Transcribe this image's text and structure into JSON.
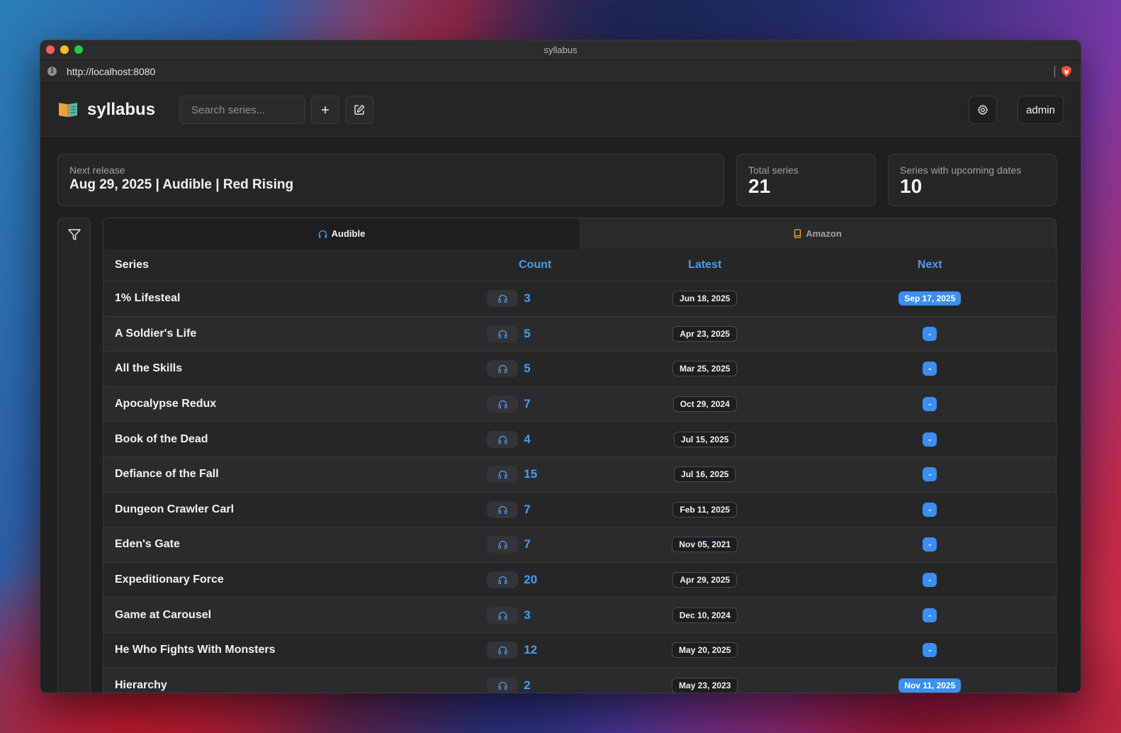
{
  "window": {
    "title": "syllabus",
    "url": "http://localhost:8080"
  },
  "header": {
    "app_name": "syllabus",
    "search_placeholder": "Search series...",
    "user_label": "admin"
  },
  "stats": {
    "next_release_label": "Next release",
    "next_release_value": "Aug 29, 2025 | Audible | Red Rising",
    "total_series_label": "Total series",
    "total_series_value": "21",
    "upcoming_label": "Series with upcoming dates",
    "upcoming_value": "10"
  },
  "tabs": [
    {
      "label": "Audible",
      "icon": "headphones-icon",
      "active": true
    },
    {
      "label": "Amazon",
      "icon": "book-icon",
      "active": false
    }
  ],
  "table": {
    "columns": [
      "Series",
      "Count",
      "Latest",
      "Next"
    ],
    "rows": [
      {
        "series": "1% Lifesteal",
        "count": "3",
        "latest": "Jun 18, 2025",
        "next": "Sep 17, 2025"
      },
      {
        "series": "A Soldier's Life",
        "count": "5",
        "latest": "Apr 23, 2025",
        "next": "-"
      },
      {
        "series": "All the Skills",
        "count": "5",
        "latest": "Mar 25, 2025",
        "next": "-"
      },
      {
        "series": "Apocalypse Redux",
        "count": "7",
        "latest": "Oct 29, 2024",
        "next": "-"
      },
      {
        "series": "Book of the Dead",
        "count": "4",
        "latest": "Jul 15, 2025",
        "next": "-"
      },
      {
        "series": "Defiance of the Fall",
        "count": "15",
        "latest": "Jul 16, 2025",
        "next": "-"
      },
      {
        "series": "Dungeon Crawler Carl",
        "count": "7",
        "latest": "Feb 11, 2025",
        "next": "-"
      },
      {
        "series": "Eden's Gate",
        "count": "7",
        "latest": "Nov 05, 2021",
        "next": "-"
      },
      {
        "series": "Expeditionary Force",
        "count": "20",
        "latest": "Apr 29, 2025",
        "next": "-"
      },
      {
        "series": "Game at Carousel",
        "count": "3",
        "latest": "Dec 10, 2024",
        "next": "-"
      },
      {
        "series": "He Who Fights With Monsters",
        "count": "12",
        "latest": "May 20, 2025",
        "next": "-"
      },
      {
        "series": "Hierarchy",
        "count": "2",
        "latest": "May 23, 2023",
        "next": "Nov 11, 2025"
      }
    ]
  },
  "colors": {
    "accent": "#4a9cf0",
    "next_pill": "#3d8ef0",
    "amazon_icon": "#f5a623"
  }
}
